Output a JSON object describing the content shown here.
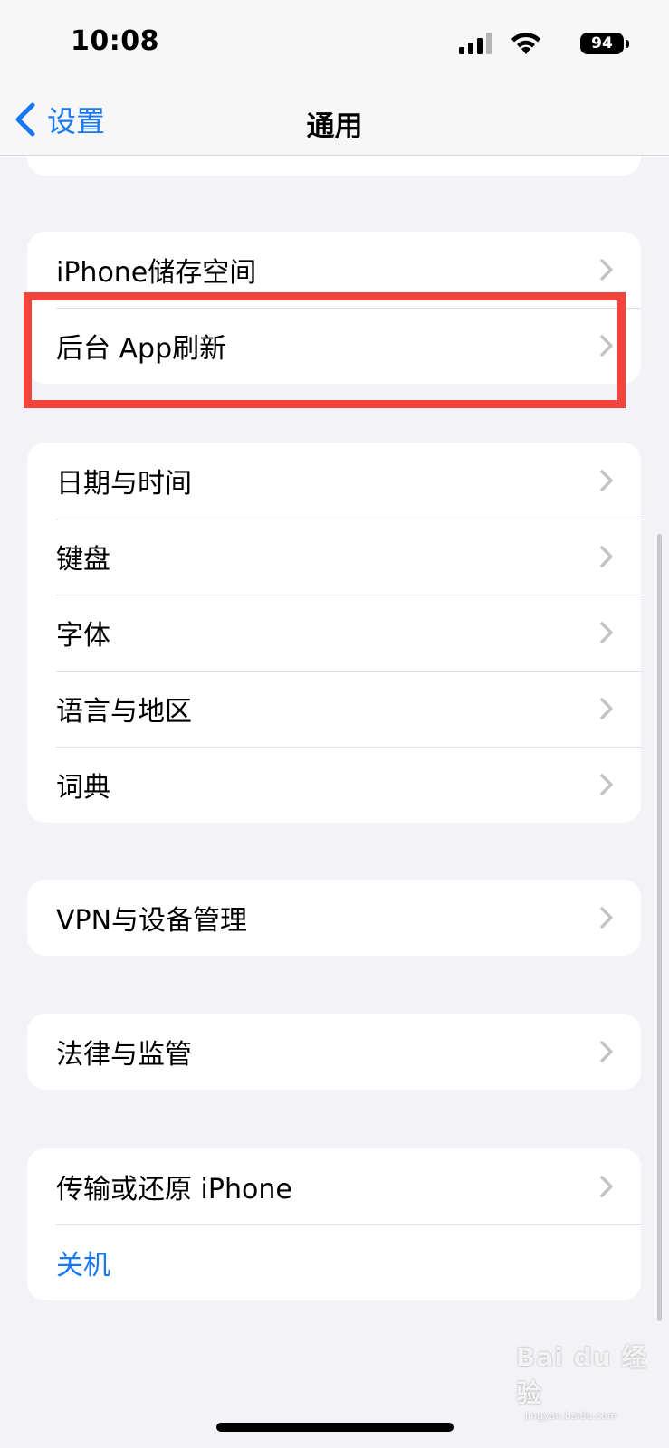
{
  "status_bar": {
    "time": "10:08",
    "battery_level": "94"
  },
  "nav": {
    "back_label": "设置",
    "title": "通用"
  },
  "groups": [
    {
      "rows": [
        {
          "label": "iPhone储存空间"
        },
        {
          "label": "后台 App刷新"
        }
      ]
    },
    {
      "rows": [
        {
          "label": "日期与时间"
        },
        {
          "label": "键盘"
        },
        {
          "label": "字体"
        },
        {
          "label": "语言与地区"
        },
        {
          "label": "词典"
        }
      ]
    },
    {
      "rows": [
        {
          "label": "VPN与设备管理"
        }
      ]
    },
    {
      "rows": [
        {
          "label": "法律与监管"
        }
      ]
    },
    {
      "rows": [
        {
          "label": "传输或还原 iPhone"
        },
        {
          "label": "关机"
        }
      ]
    }
  ],
  "watermark": {
    "main": "Bai du 经验",
    "sub": "jingyan.baidu.com"
  },
  "colors": {
    "accent": "#1877f2",
    "highlight": "#f2433c",
    "background": "#f2f2f7"
  }
}
